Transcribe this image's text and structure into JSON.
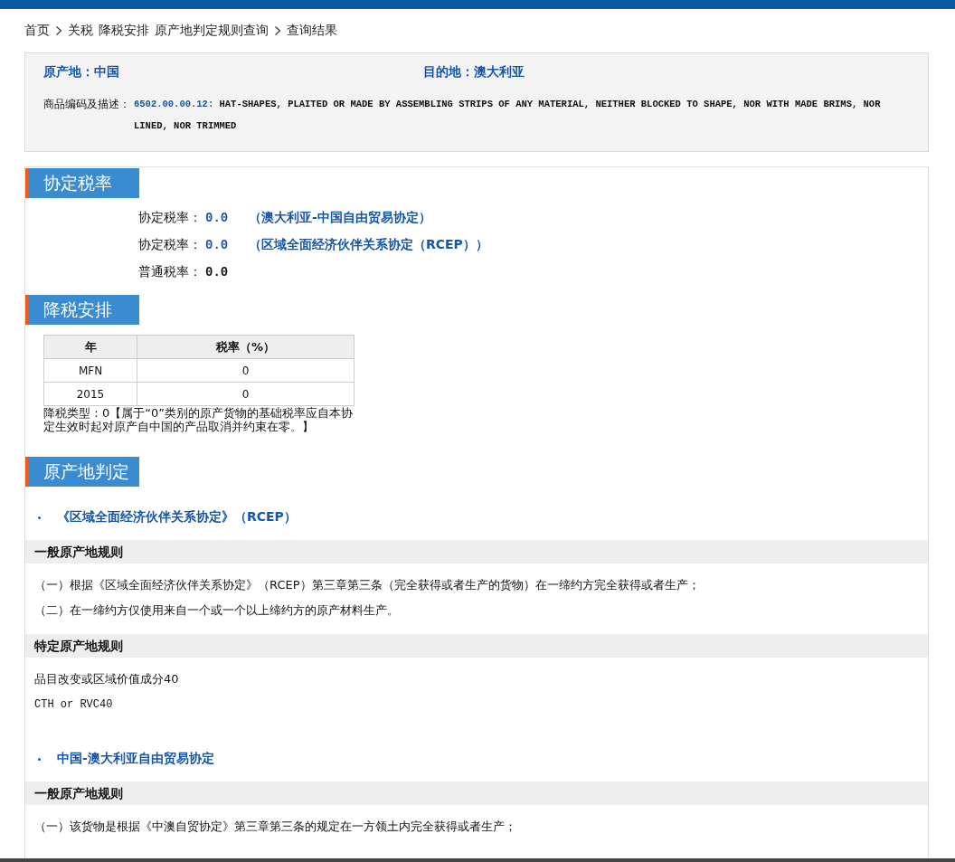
{
  "breadcrumb": [
    {
      "label": "首页",
      "separator_before": false
    },
    {
      "label": "关税",
      "separator_before": true
    },
    {
      "label": "降税安排",
      "separator_before": false
    },
    {
      "label": "原产地判定规则查询",
      "separator_before": false
    },
    {
      "label": "查询结果",
      "separator_before": true
    }
  ],
  "info": {
    "origin_label": "原产地：",
    "origin": "中国",
    "destination_label": "目的地：",
    "destination": "澳大利亚",
    "code_label": "商品编码及描述：",
    "code": "6502.00.00.12:",
    "description": "HAT-SHAPES, PLAITED OR MADE BY ASSEMBLING STRIPS OF ANY MATERIAL, NEITHER BLOCKED TO SHAPE, NOR WITH MADE BRIMS, NOR LINED, NOR TRIMMED"
  },
  "sections": [
    {
      "kind": "rates",
      "title": "协定税率",
      "rates": [
        {
          "kind": "agreement",
          "label": "协定税率：",
          "value": "0.0",
          "agreement": "（澳大利亚-中国自由贸易协定）"
        },
        {
          "kind": "agreement",
          "label": "协定税率：",
          "value": "0.0",
          "agreement": "（区域全面经济伙伴关系协定（RCEP））"
        },
        {
          "kind": "general",
          "label": "普通税率：",
          "value": "0.0"
        }
      ]
    },
    {
      "kind": "schedule",
      "title": "降税安排",
      "columns": [
        "年",
        "税率（%）"
      ],
      "rows": [
        [
          "MFN",
          "0"
        ],
        [
          "2015",
          "0"
        ]
      ],
      "note": "降税类型：0【属于“0”类别的原产货物的基础税率应自本协定生效时起对原产自中国的产品取消并约束在零。】"
    },
    {
      "kind": "origin",
      "title": "原产地判定",
      "agreements": [
        {
          "name": "《区域全面经济伙伴关系协定》（RCEP）",
          "groups": [
            {
              "heading": "一般原产地规则",
              "lines": [
                {
                  "kind": "text",
                  "text": "（一）根据《区域全面经济伙伴关系协定》（RCEP）第三章第三条（完全获得或者生产的货物）在一缔约方完全获得或者生产；"
                },
                {
                  "kind": "text",
                  "text": "（二）在一缔约方仅使用来自一个或一个以上缔约方的原产材料生产。"
                }
              ]
            },
            {
              "heading": "特定原产地规则",
              "lines": [
                {
                  "kind": "text",
                  "text": "品目改变或区域价值成分40"
                },
                {
                  "kind": "code",
                  "text": "CTH or RVC40"
                }
              ]
            }
          ]
        },
        {
          "name": "中国-澳大利亚自由贸易协定",
          "groups": [
            {
              "heading": "一般原产地规则",
              "lines": [
                {
                  "kind": "text",
                  "text": "（一）该货物是根据《中澳自贸协定》第三章第三条的规定在一方领土内完全获得或者生产；"
                }
              ]
            }
          ]
        }
      ]
    }
  ]
}
